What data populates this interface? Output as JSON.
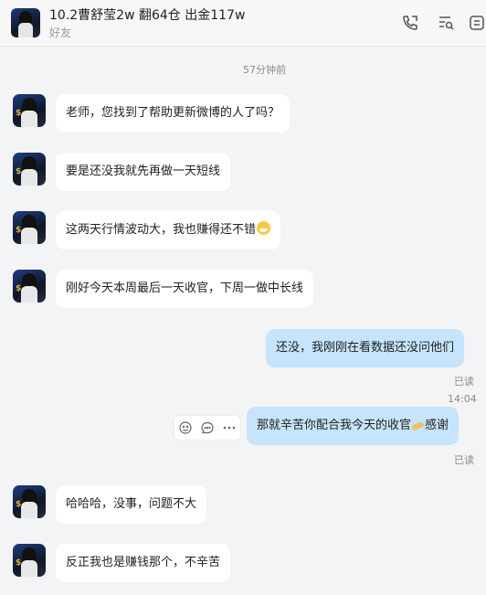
{
  "header": {
    "title": "10.2曹舒莹2w 翻64仓 出金117w",
    "subtitle": "好友",
    "icons": [
      "phone-icon",
      "list-search-icon",
      "more-icon"
    ]
  },
  "timestamp_top": "57分钟前",
  "messages": [
    {
      "side": "in",
      "text": "老师，您找到了帮助更新微博的人了吗？"
    },
    {
      "side": "in",
      "text": "要是还没我就先再做一天短线"
    },
    {
      "side": "in",
      "text": "这两天行情波动大，我也赚得还不错"
    },
    {
      "side": "in",
      "text": "刚好今天本周最后一天收官，下周一做中长线"
    },
    {
      "side": "out",
      "text": "还没，我刚刚在看数据还没问他们",
      "status": "已读"
    },
    {
      "side": "out",
      "text": "那就辛苦你配合我今天的收官",
      "suffix": "感谢",
      "status": "已读"
    },
    {
      "side": "in",
      "text": "哈哈哈，没事，问题不大"
    },
    {
      "side": "in",
      "text": "反正我也是赚钱那个，不辛苦"
    }
  ],
  "timestamp_mid": "14:04",
  "colors": {
    "outgoing_bubble": "#c6e4fb",
    "incoming_bubble": "#ffffff",
    "background": "#f3f4f6"
  }
}
